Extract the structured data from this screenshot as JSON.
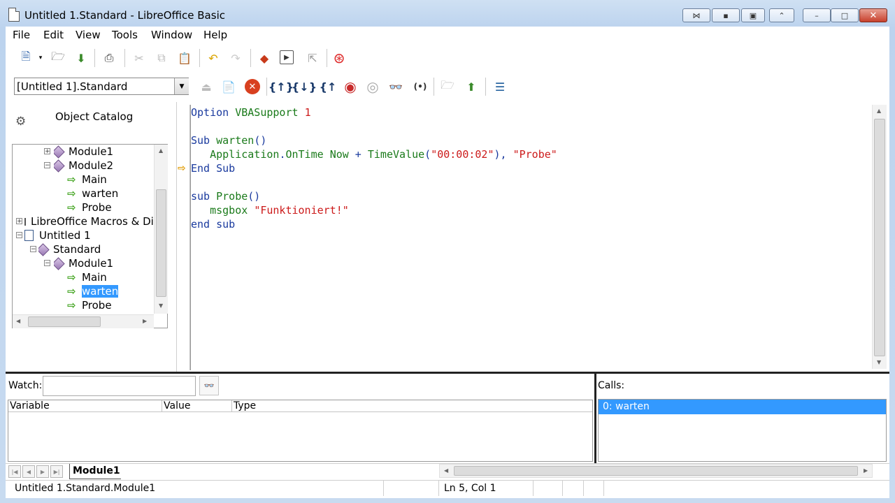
{
  "window": {
    "title": "Untitled 1.Standard - LibreOffice Basic",
    "controls": {
      "minimize": "–",
      "maximize": "□",
      "close": "✕"
    }
  },
  "menu": [
    "File",
    "Edit",
    "View",
    "Tools",
    "Window",
    "Help"
  ],
  "toolbar": {
    "library_select": "[Untitled 1].Standard"
  },
  "object_catalog": {
    "title": "Object Catalog",
    "tree": [
      {
        "label": "Module1",
        "type": "module",
        "expander": "+"
      },
      {
        "label": "Module2",
        "type": "module",
        "expander": "−"
      },
      {
        "label": "Main",
        "type": "method"
      },
      {
        "label": "warten",
        "type": "method"
      },
      {
        "label": "Probe",
        "type": "method"
      },
      {
        "label": "LibreOffice Macros & Dia",
        "type": "library",
        "expander": "+"
      },
      {
        "label": "Untitled 1",
        "type": "document",
        "expander": "−"
      },
      {
        "label": "Standard",
        "type": "library",
        "expander": "−"
      },
      {
        "label": "Module1",
        "type": "module",
        "expander": "−"
      },
      {
        "label": "Main",
        "type": "method"
      },
      {
        "label": "warten",
        "type": "method",
        "selected": true
      },
      {
        "label": "Probe",
        "type": "method"
      }
    ]
  },
  "editor": {
    "lines": [
      [
        {
          "t": "Option",
          "c": "kw"
        },
        {
          "t": " ",
          "c": ""
        },
        {
          "t": "VBASupport",
          "c": "id"
        },
        {
          "t": " ",
          "c": ""
        },
        {
          "t": "1",
          "c": "str"
        }
      ],
      [],
      [
        {
          "t": "Sub",
          "c": "kw"
        },
        {
          "t": " ",
          "c": ""
        },
        {
          "t": "warten",
          "c": "id"
        },
        {
          "t": "()",
          "c": "op"
        }
      ],
      [
        {
          "t": "   ",
          "c": ""
        },
        {
          "t": "Application",
          "c": "id"
        },
        {
          "t": ".",
          "c": "op"
        },
        {
          "t": "OnTime",
          "c": "id"
        },
        {
          "t": " ",
          "c": ""
        },
        {
          "t": "Now",
          "c": "id"
        },
        {
          "t": " + ",
          "c": "op"
        },
        {
          "t": "TimeValue",
          "c": "id"
        },
        {
          "t": "(",
          "c": "op"
        },
        {
          "t": "\"00:00:02\"",
          "c": "str"
        },
        {
          "t": "), ",
          "c": "op"
        },
        {
          "t": "\"Probe\"",
          "c": "str"
        }
      ],
      [
        {
          "t": "End",
          "c": "kw"
        },
        {
          "t": " ",
          "c": ""
        },
        {
          "t": "Sub",
          "c": "kw"
        }
      ],
      [],
      [
        {
          "t": "sub",
          "c": "kw"
        },
        {
          "t": " ",
          "c": ""
        },
        {
          "t": "Probe",
          "c": "id"
        },
        {
          "t": "()",
          "c": "op"
        }
      ],
      [
        {
          "t": "   ",
          "c": ""
        },
        {
          "t": "msgbox",
          "c": "id"
        },
        {
          "t": " ",
          "c": ""
        },
        {
          "t": "\"Funktioniert!\"",
          "c": "str"
        }
      ],
      [
        {
          "t": "end",
          "c": "kw"
        },
        {
          "t": " ",
          "c": ""
        },
        {
          "t": "sub",
          "c": "kw"
        }
      ]
    ]
  },
  "watch": {
    "label": "Watch:",
    "input_value": "",
    "columns": [
      "Variable",
      "Value",
      "Type"
    ]
  },
  "calls": {
    "label": "Calls:",
    "items": [
      "0: warten"
    ]
  },
  "tabs": [
    "Module1"
  ],
  "status": {
    "location": "Untitled 1.Standard.Module1",
    "cursor": "Ln 5, Col 1"
  },
  "colors": {
    "keyword": "#1a3a9e",
    "identifier": "#1a7a1a",
    "string": "#cc1a1a",
    "selection": "#3399ff",
    "window_frame": "#cfe0f3"
  },
  "icons": [
    "new-document-icon",
    "open-icon",
    "save-icon",
    "print-icon",
    "cut-icon",
    "copy-icon",
    "paste-icon",
    "undo-icon",
    "redo-icon",
    "select-macro-icon",
    "select-module-icon",
    "extension-icon",
    "help-icon",
    "compile-icon",
    "insert-source-icon",
    "stop-icon",
    "step-into-icon",
    "step-over-icon",
    "step-out-icon",
    "breakpoint-icon",
    "manage-breakpoints-icon",
    "enable-watch-icon",
    "find-parentheses-icon",
    "import-basic-icon",
    "export-basic-icon",
    "object-catalog-icon"
  ]
}
